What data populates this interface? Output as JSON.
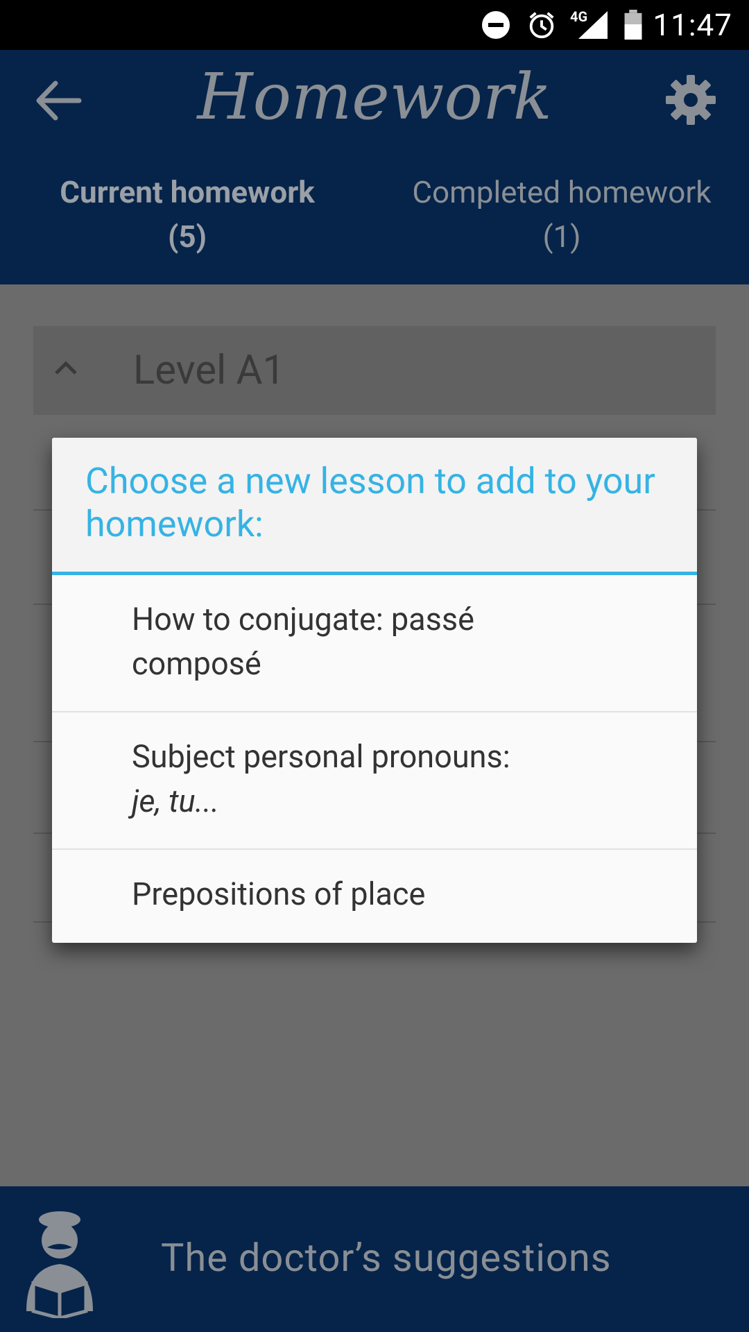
{
  "status_bar": {
    "time": "11:47",
    "network": "4G",
    "icons": [
      "do-not-disturb-icon",
      "alarm-icon",
      "signal-icon",
      "battery-icon"
    ]
  },
  "app_bar": {
    "title": "Homework",
    "back_icon": "back-arrow-icon",
    "settings_icon": "gear-icon",
    "tabs": [
      {
        "label": "Current homework",
        "count": "(5)",
        "selected": true
      },
      {
        "label": "Completed homework",
        "count": "(1)",
        "selected": false
      }
    ]
  },
  "content": {
    "level_label": "Level A1",
    "level_icon": "chevron-up-icon"
  },
  "dialog": {
    "title": "Choose a new lesson to add to your homework:",
    "options": [
      {
        "line1": "How to conjugate: passé",
        "line2": "composé"
      },
      {
        "line1": "Subject personal pronouns:",
        "line2": "je, tu..."
      },
      {
        "line1": "Prepositions of place"
      }
    ]
  },
  "bottom_bar": {
    "label": "The doctor’s suggestions",
    "icon": "doctor-reading-icon"
  },
  "colors": {
    "app_bar": "#06244a",
    "accent": "#35b3e4",
    "scrim_bg": "#6b6b6b"
  }
}
